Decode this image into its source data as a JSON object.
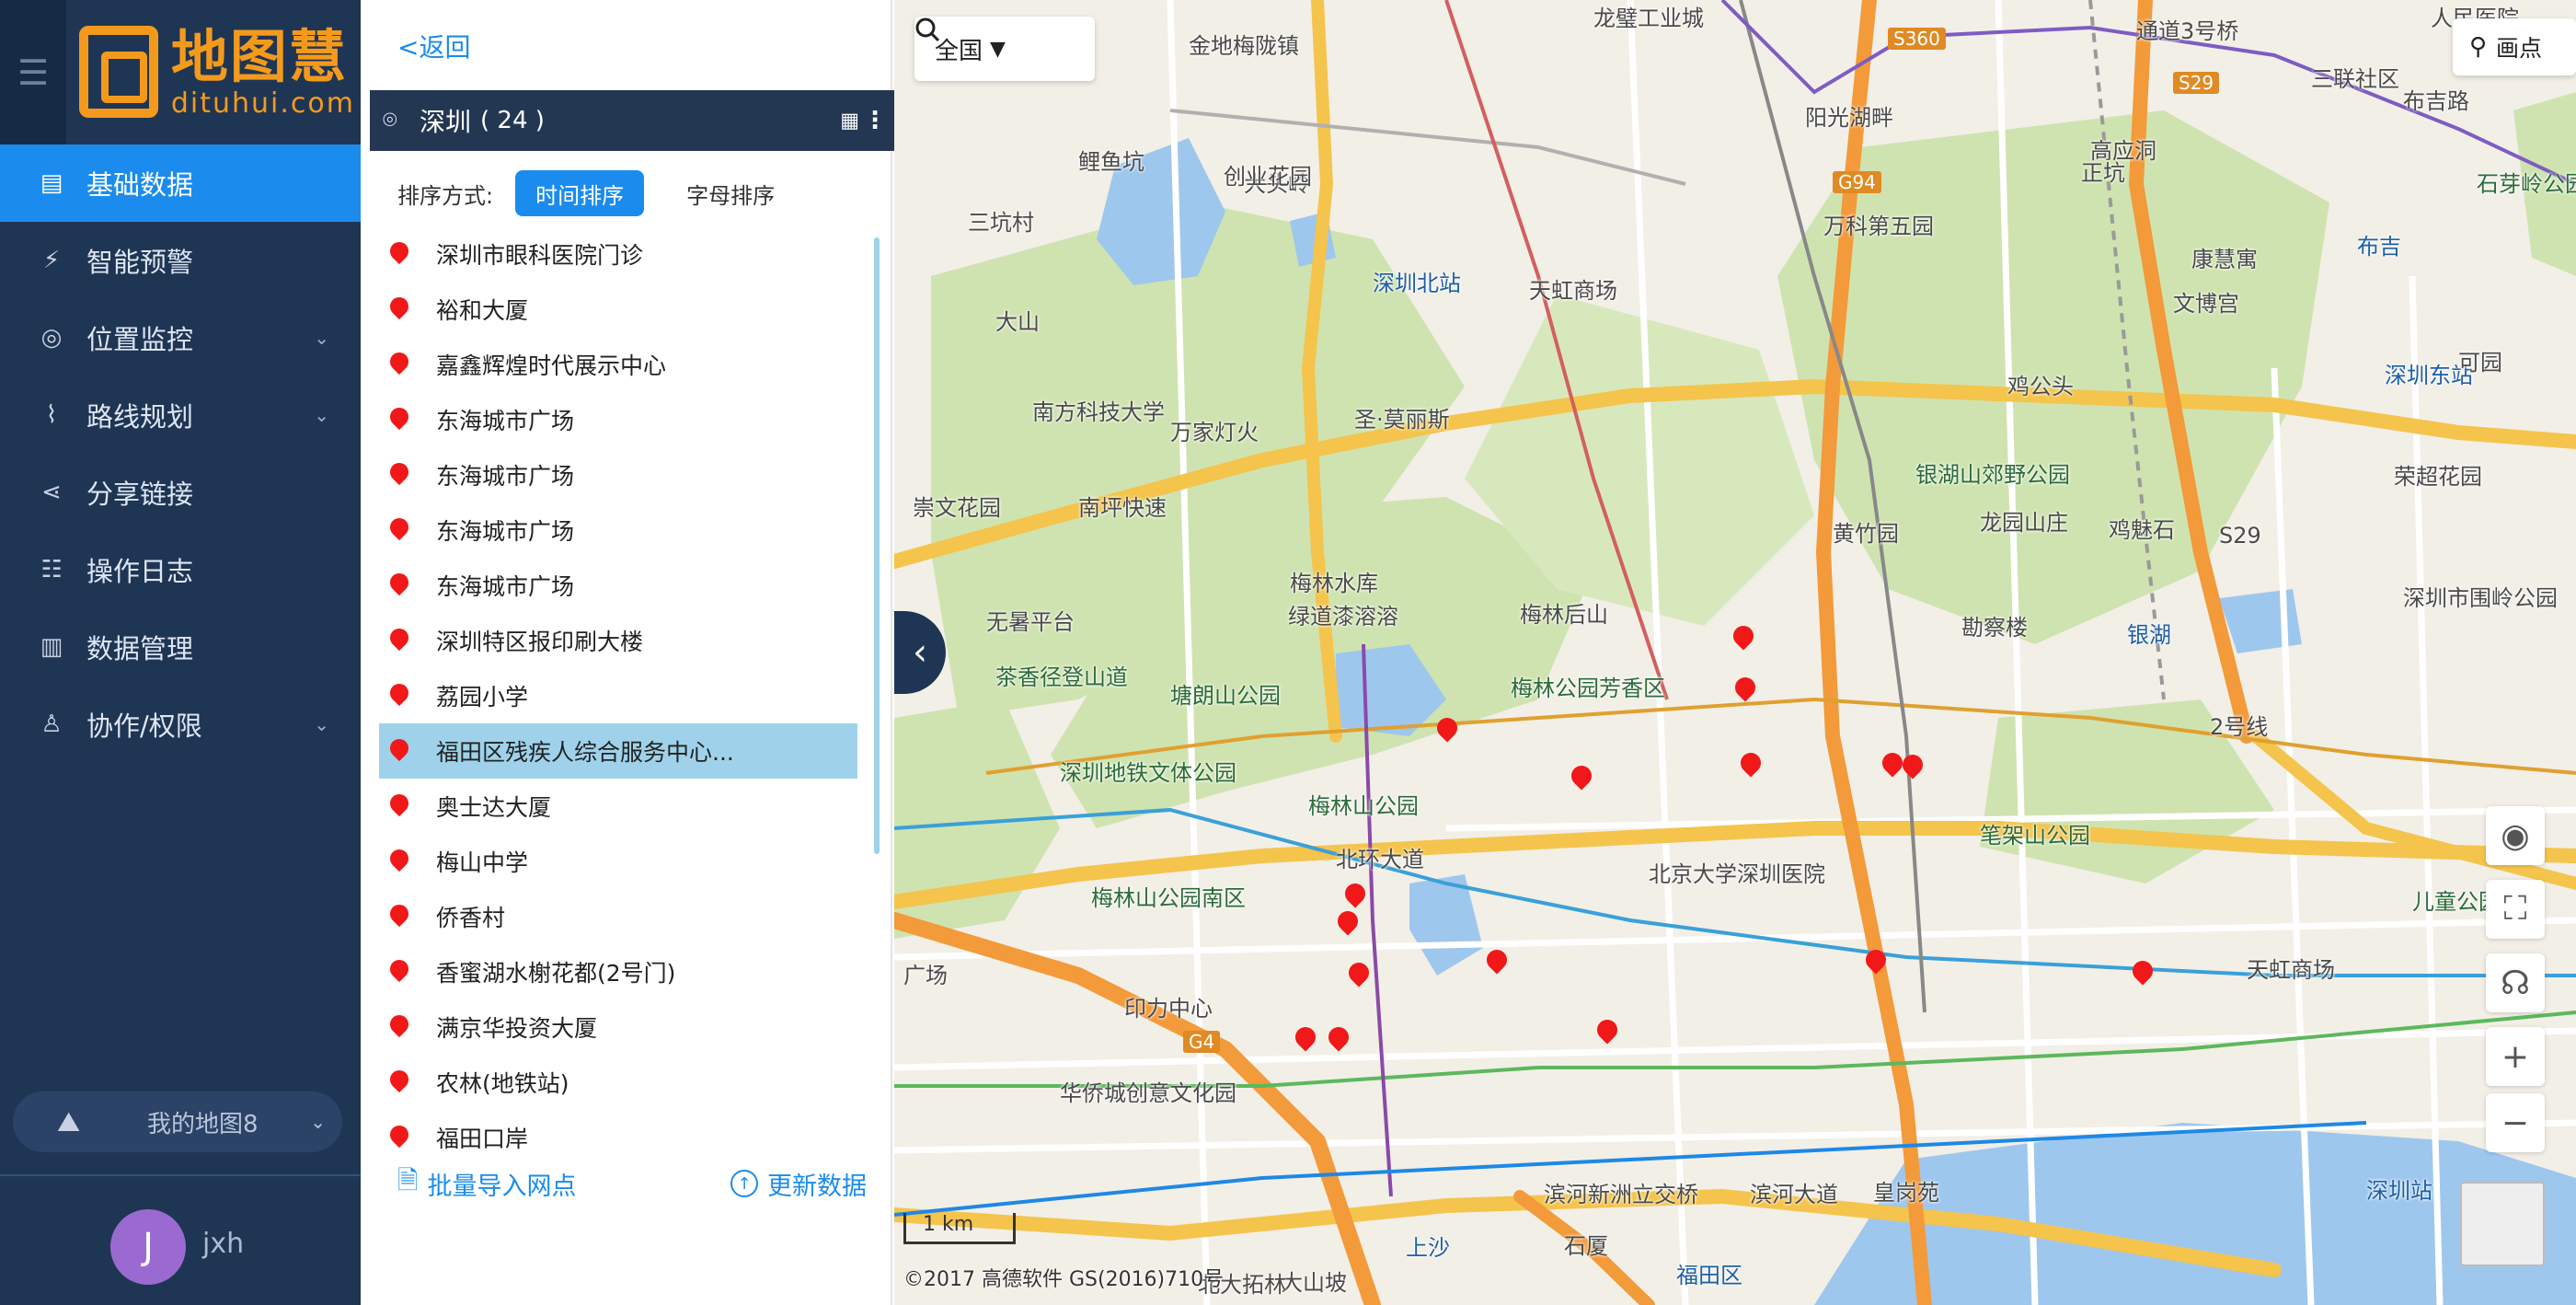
{
  "nav": {
    "logo_cn": "地图慧",
    "logo_en": "dituhui.com",
    "items": [
      {
        "label": "基础数据",
        "icon": "database-icon",
        "active": true,
        "caret": false
      },
      {
        "label": "智能预警",
        "icon": "alert-icon",
        "active": false,
        "caret": false
      },
      {
        "label": "位置监控",
        "icon": "location-monitor-icon",
        "active": false,
        "caret": true
      },
      {
        "label": "路线规划",
        "icon": "route-icon",
        "active": false,
        "caret": true
      },
      {
        "label": "分享链接",
        "icon": "share-icon",
        "active": false,
        "caret": false
      },
      {
        "label": "操作日志",
        "icon": "log-icon",
        "active": false,
        "caret": false
      },
      {
        "label": "数据管理",
        "icon": "data-manage-icon",
        "active": false,
        "caret": false
      },
      {
        "label": "协作/权限",
        "icon": "user-permission-icon",
        "active": false,
        "caret": true
      }
    ],
    "my_map": "我的地图8",
    "user_initial": "J",
    "user_name": "jxh"
  },
  "panel": {
    "back": "<返回",
    "city": "深圳",
    "count": "( 24 )",
    "sort_label": "排序方式:",
    "sort_time": "时间排序",
    "sort_alpha": "字母排序",
    "items": [
      "深圳市眼科医院门诊",
      "裕和大厦",
      "嘉鑫辉煌时代展示中心",
      "东海城市广场",
      "东海城市广场",
      "东海城市广场",
      "东海城市广场",
      "深圳特区报印刷大楼",
      "荔园小学",
      "福田区残疾人综合服务中心...",
      "奥士达大厦",
      "梅山中学",
      "侨香村",
      "香蜜湖水榭花都(2号门)",
      "满京华投资大厦",
      "农林(地铁站)",
      "福田口岸"
    ],
    "selected_index": 9,
    "import": "批量导入网点",
    "update": "更新数据"
  },
  "map": {
    "region": "全国",
    "draw_point": "画点",
    "scale": "1 km",
    "copyright": "©2017 高德软件 GS(2016)710号",
    "labels": [
      "龙璧工业城",
      "金地梅陇镇",
      "S360",
      "通道3号桥",
      "人民医院",
      "三联社区",
      "布吉路",
      "阳光湖畔",
      "大头岭",
      "创业花园",
      "G94",
      "S29",
      "高应洞",
      "石芽岭公园",
      "鲤鱼坑",
      "三坑村",
      "万科第五园",
      "正坑",
      "布吉",
      "大山",
      "深圳北站",
      "天虹商场",
      "康慧寓",
      "文博宫",
      "深圳东站",
      "可园",
      "南方科技大学",
      "圣·莫丽斯",
      "万家灯火",
      "鸡公头",
      "荣超花园",
      "银湖山郊野公园",
      "崇文花园",
      "南坪快速",
      "龙园山庄",
      "黄竹园",
      "鸡魅石",
      "S29",
      "深圳市围岭公园",
      "梅林水库",
      "绿道漆溶溶",
      "无暑平台",
      "梅林后山",
      "勘察楼",
      "银湖",
      "茶香径登山道",
      "塘朗山公园",
      "梅林公园芳香区",
      "2号线",
      "深圳地铁文体公园",
      "梅林山公园",
      "北环大道",
      "北京大学深圳医院",
      "笔架山公园",
      "梅林山公园南区",
      "儿童公园",
      "天虹商场",
      "印力中心",
      "G4",
      "华侨城创意文化园",
      "滨河新洲立交桥",
      "滨河大道",
      "皇岗苑",
      "上沙",
      "福田区",
      "石厦",
      "广场",
      "深圳站",
      "大山坡",
      "北大拓林"
    ],
    "pin_count": 16
  }
}
